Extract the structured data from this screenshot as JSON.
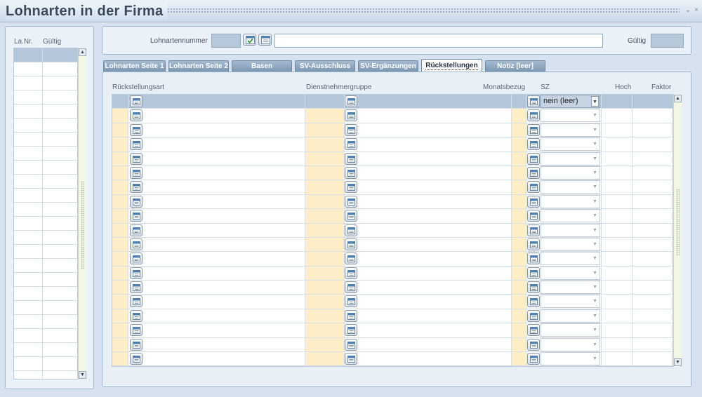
{
  "window": {
    "title": "Lohnarten in der Firma",
    "minimize_glyph": "⌄",
    "close_glyph": "×"
  },
  "left_list": {
    "col_nr": "La.Nr.",
    "col_valid": "Gültig"
  },
  "header": {
    "wage_number_label": "Lohnartennummer",
    "valid_label": "Gültig",
    "wage_number_value": "",
    "description_value": "",
    "valid_value": ""
  },
  "tabs": [
    {
      "label": "Lohnarten Seite 1"
    },
    {
      "label": "Lohnarten Seite 2"
    },
    {
      "label": "Basen"
    },
    {
      "label": "SV-Ausschluss"
    },
    {
      "label": "SV-Ergänzungen"
    },
    {
      "label": "Rückstellungen"
    },
    {
      "label": "Notiz [leer]"
    }
  ],
  "active_tab": "Rückstellungen",
  "grid": {
    "columns": {
      "provision_type": "Rückstellungsart",
      "employee_group": "Dienstnehmergruppe",
      "monthly_ref": "Monatsbezug",
      "sz": "SZ",
      "high": "Hoch",
      "factor": "Faktor"
    },
    "first_sz_value": "nein (leer)",
    "row_count": 19
  },
  "icons": {
    "lookup": "list-lookup-icon",
    "confirm": "checkmark-icon",
    "dropdown": "chevron-down-icon",
    "scroll_up": "arrow-up-icon",
    "scroll_down": "arrow-down-icon"
  },
  "colors": {
    "highlight": "#fdeec7",
    "selected_row": "#b4c6d9",
    "tab": "#8aa3bd",
    "background": "#d6e2ef"
  }
}
